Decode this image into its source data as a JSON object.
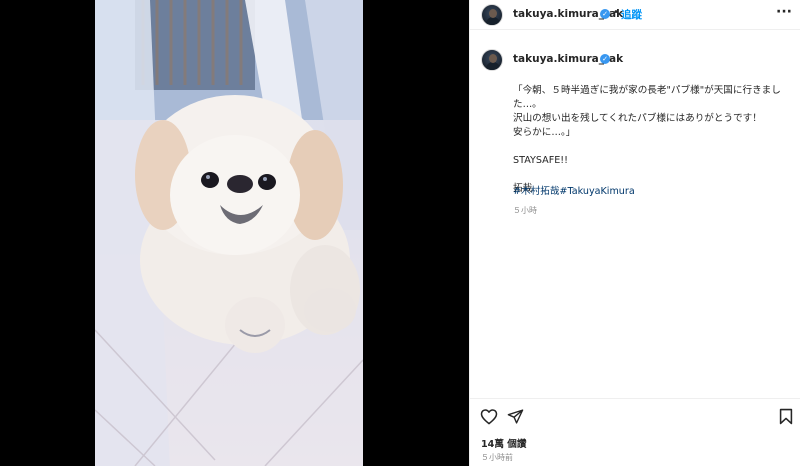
{
  "header": {
    "username": "takuya.kimura_tak",
    "separator": "•",
    "follow_label": "追蹤",
    "more_label": "···"
  },
  "caption": {
    "username": "takuya.kimura_tak",
    "lines": [
      "「今朝、５時半過ぎに我が家の長老\"パブ様\"が天国に行きまし",
      "た…。",
      "沢山の想い出を残してくれたパブ様にはありがとうです！",
      "安らかに…。」",
      "STAYSAFE!!",
      "拓哉"
    ],
    "hashtags": [
      "#木村拓哉",
      "#TakuyaKimura"
    ],
    "time": "５小時"
  },
  "footer": {
    "likes": "14萬 個讚",
    "time": "５小時前"
  },
  "icons": {
    "verified": "verified-badge-icon",
    "like": "heart-icon",
    "share": "paper-plane-icon",
    "save": "bookmark-icon"
  },
  "colors": {
    "link": "#0095f6",
    "hashtag": "#00376b",
    "verified": "#3897f0",
    "muted": "#8e8e8e"
  }
}
